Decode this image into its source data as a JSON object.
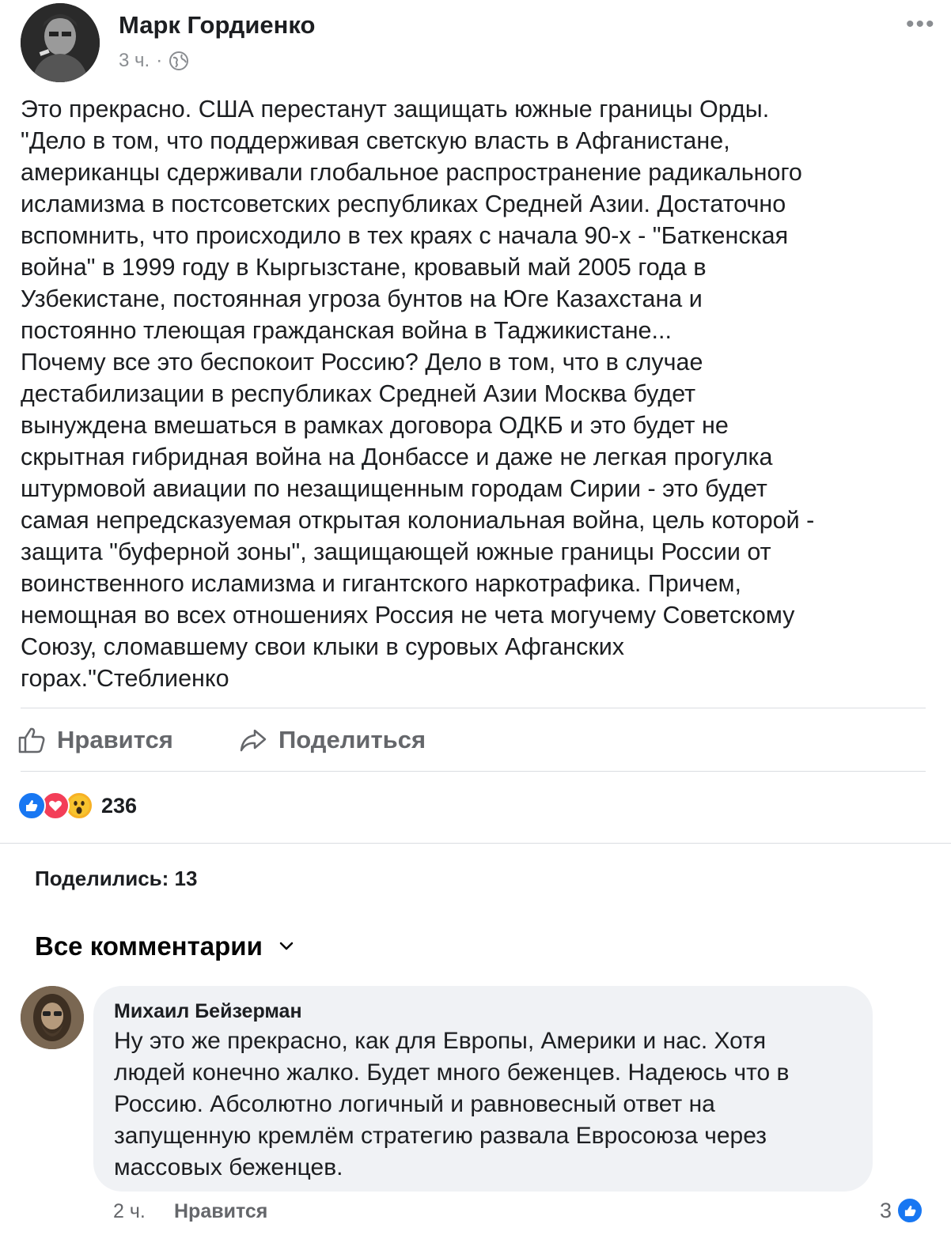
{
  "post": {
    "author": "Марк Гордиенко",
    "time": "3 ч.",
    "separator": "·",
    "privacy_icon": "globe-icon",
    "more_icon": "•••",
    "text_lines": [
      "Это прекрасно. США перестанут защищать южные границы Орды.",
      "\"Дело в том, что поддерживая светскую власть в Афганистане,",
      "американцы сдерживали глобальное распространение радикального",
      "исламизма в постсоветских республиках Средней Азии. Достаточно",
      "вспомнить, что происходило в тех краях с начала 90-х - \"Баткенская",
      "война\" в  1999 году в Кыргызстане, кровавый май 2005 года в",
      "Узбекистане, постоянная угроза бунтов на Юге Казахстана и",
      "постоянно тлеющая гражданская война в Таджикистане...",
      "Почему все это беспокоит Россию? Дело в том, что в случае",
      "дестабилизации в республиках Средней Азии Москва будет",
      "вынуждена вмешаться в рамках договора ОДКБ и это будет не",
      "скрытная гибридная война на Донбассе и даже не легкая прогулка",
      "штурмовой авиации по незащищенным городам Сирии - это будет",
      "самая непредсказуемая открытая колониальная война, цель которой -",
      "защита \"буферной зоны\", защищающей южные границы России от",
      "воинственного исламизма и гигантского наркотрафика. Причем,",
      "немощная во всех отношениях Россия не чета могучему Советскому",
      "Союзу, сломавшему свои клыки в суровых Афганских",
      "горах.\"Стеблиенко"
    ],
    "actions": {
      "like_label": "Нравится",
      "share_label": "Поделиться"
    },
    "reactions": {
      "types": [
        "like",
        "love",
        "wow"
      ],
      "count": "236"
    },
    "shares_label": "Поделились: 13"
  },
  "comments": {
    "header": "Все комментарии",
    "items": [
      {
        "author": "Михаил Бейзерман",
        "text_lines": [
          "Ну это же прекрасно, как для Европы, Америки и нас. Хотя",
          "людей конечно жалко. Будет много беженцев. Надеюсь что в",
          "Россию. Абсолютно логичный и равновесный ответ на",
          "запущенную кремлём стратегию развала Евросоюза через",
          "массовых беженцев."
        ],
        "time": "2 ч.",
        "like_label": "Нравится",
        "reaction_count": "3"
      }
    ]
  },
  "colors": {
    "accent": "#1877f2",
    "love": "#f33e58",
    "wow": "#f7b125",
    "secondary_text": "#65676b",
    "bubble_bg": "#f0f2f5"
  }
}
